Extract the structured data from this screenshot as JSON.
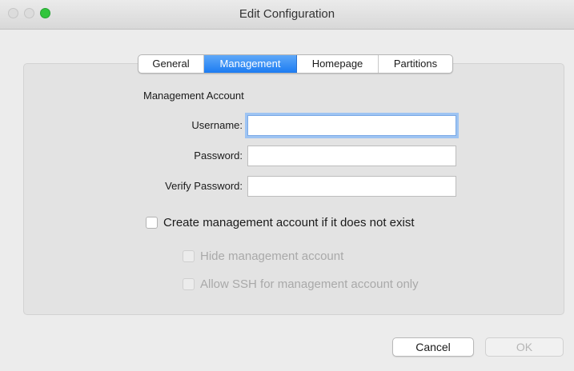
{
  "window": {
    "title": "Edit Configuration"
  },
  "tabs": [
    {
      "label": "General"
    },
    {
      "label": "Management",
      "active": true
    },
    {
      "label": "Homepage"
    },
    {
      "label": "Partitions"
    }
  ],
  "management": {
    "section_title": "Management Account",
    "username": {
      "label": "Username:",
      "value": ""
    },
    "password": {
      "label": "Password:",
      "value": ""
    },
    "verify_password": {
      "label": "Verify Password:",
      "value": ""
    },
    "create_if_missing": {
      "label": "Create management account if it does not exist",
      "checked": false
    },
    "hide_account": {
      "label": "Hide management account",
      "checked": false,
      "disabled": true
    },
    "allow_ssh": {
      "label": "Allow SSH for management account only",
      "checked": false,
      "disabled": true
    }
  },
  "buttons": {
    "cancel": "Cancel",
    "ok": "OK"
  },
  "colors": {
    "accent": "#1c7cf2",
    "zoom_button": "#32c53d"
  }
}
